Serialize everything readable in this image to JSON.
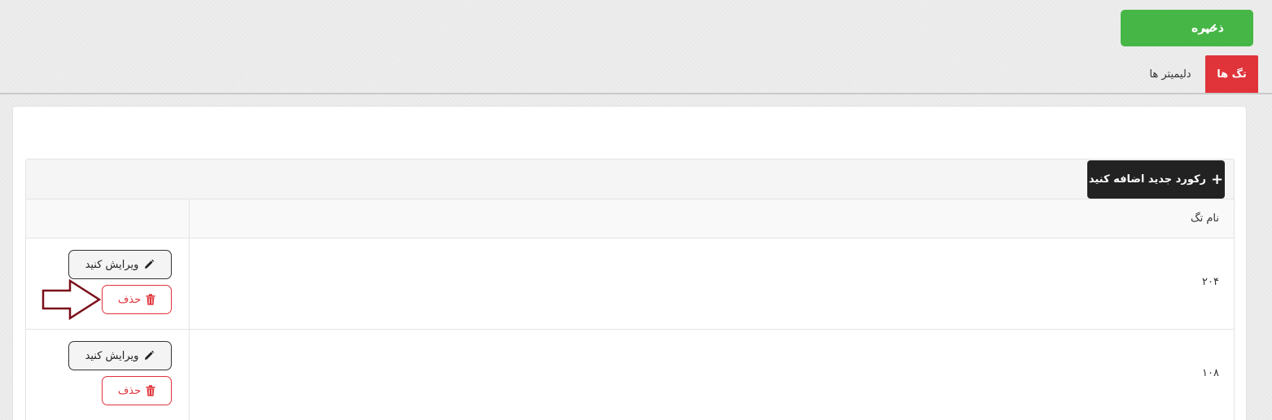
{
  "toolbar": {
    "save_label": "ذخیره"
  },
  "tabs": [
    {
      "label": "تگ ها",
      "active": true
    },
    {
      "label": "دلیمیتر ها",
      "active": false
    }
  ],
  "panel": {
    "add_label": "رکورد جدید اضافه کنید"
  },
  "table": {
    "column_header": "نام تگ",
    "rows": [
      {
        "name": "۲۰۴",
        "edit_label": "ویرایش کنید",
        "delete_label": "حذف"
      },
      {
        "name": "۱۰۸",
        "edit_label": "ویرایش کنید",
        "delete_label": "حذف"
      }
    ]
  },
  "colors": {
    "save_green": "#46b646",
    "tab_red": "#e0333a",
    "add_black": "#222222",
    "annotation_arrow": "#7a0f1a"
  }
}
